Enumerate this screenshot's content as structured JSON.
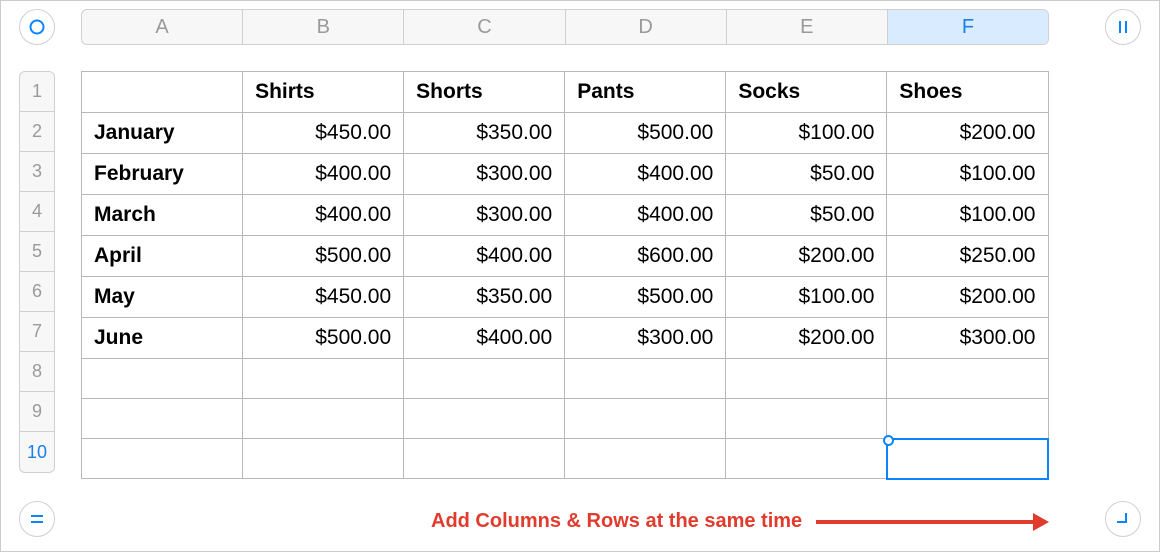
{
  "columns": [
    "A",
    "B",
    "C",
    "D",
    "E",
    "F"
  ],
  "selected_column_index": 5,
  "row_numbers": [
    1,
    2,
    3,
    4,
    5,
    6,
    7,
    8,
    9,
    10
  ],
  "selected_row_index": 9,
  "rows": [
    [
      "",
      "Shirts",
      "Shorts",
      "Pants",
      "Socks",
      "Shoes"
    ],
    [
      "January",
      "$450.00",
      "$350.00",
      "$500.00",
      "$100.00",
      "$200.00"
    ],
    [
      "February",
      "$400.00",
      "$300.00",
      "$400.00",
      "$50.00",
      "$100.00"
    ],
    [
      "March",
      "$400.00",
      "$300.00",
      "$400.00",
      "$50.00",
      "$100.00"
    ],
    [
      "April",
      "$500.00",
      "$400.00",
      "$600.00",
      "$200.00",
      "$250.00"
    ],
    [
      "May",
      "$450.00",
      "$350.00",
      "$500.00",
      "$100.00",
      "$200.00"
    ],
    [
      "June",
      "$500.00",
      "$400.00",
      "$300.00",
      "$200.00",
      "$300.00"
    ],
    [
      "",
      "",
      "",
      "",
      "",
      ""
    ],
    [
      "",
      "",
      "",
      "",
      "",
      ""
    ],
    [
      "",
      "",
      "",
      "",
      "",
      ""
    ]
  ],
  "selected_cell": {
    "row": 9,
    "col": 5
  },
  "annotation": "Add Columns & Rows at the same time"
}
